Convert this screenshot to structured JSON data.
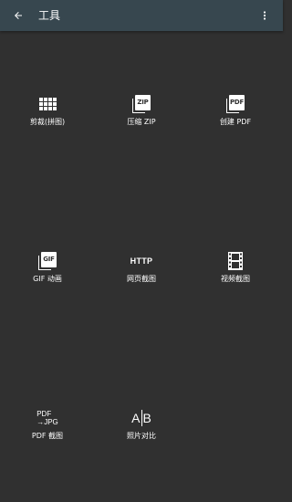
{
  "appbar": {
    "title": "工具",
    "background": "#37474f"
  },
  "colors": {
    "page_background": "#303030",
    "icon": "#ffffff",
    "text": "#ffffff"
  },
  "tools": [
    {
      "label": "剪裁(拼图)",
      "icon": "grid-icon"
    },
    {
      "label": "压缩 ZIP",
      "icon": "zip-file-icon",
      "badge": "ZIP"
    },
    {
      "label": "创建 PDF",
      "icon": "pdf-file-icon",
      "badge": "PDF"
    },
    {
      "label": "GIF 动画",
      "icon": "gif-file-icon",
      "badge": "GIF"
    },
    {
      "label": "网页截图",
      "icon": "http-icon",
      "badge": "HTTP"
    },
    {
      "label": "视频截图",
      "icon": "film-strip-icon"
    },
    {
      "label": "PDF 截图",
      "icon": "pdf-to-jpg-icon",
      "badge_top": "PDF",
      "badge_bottom": "→JPG"
    },
    {
      "label": "照片对比",
      "icon": "compare-ab-icon",
      "badge_a": "A",
      "badge_b": "B"
    }
  ]
}
